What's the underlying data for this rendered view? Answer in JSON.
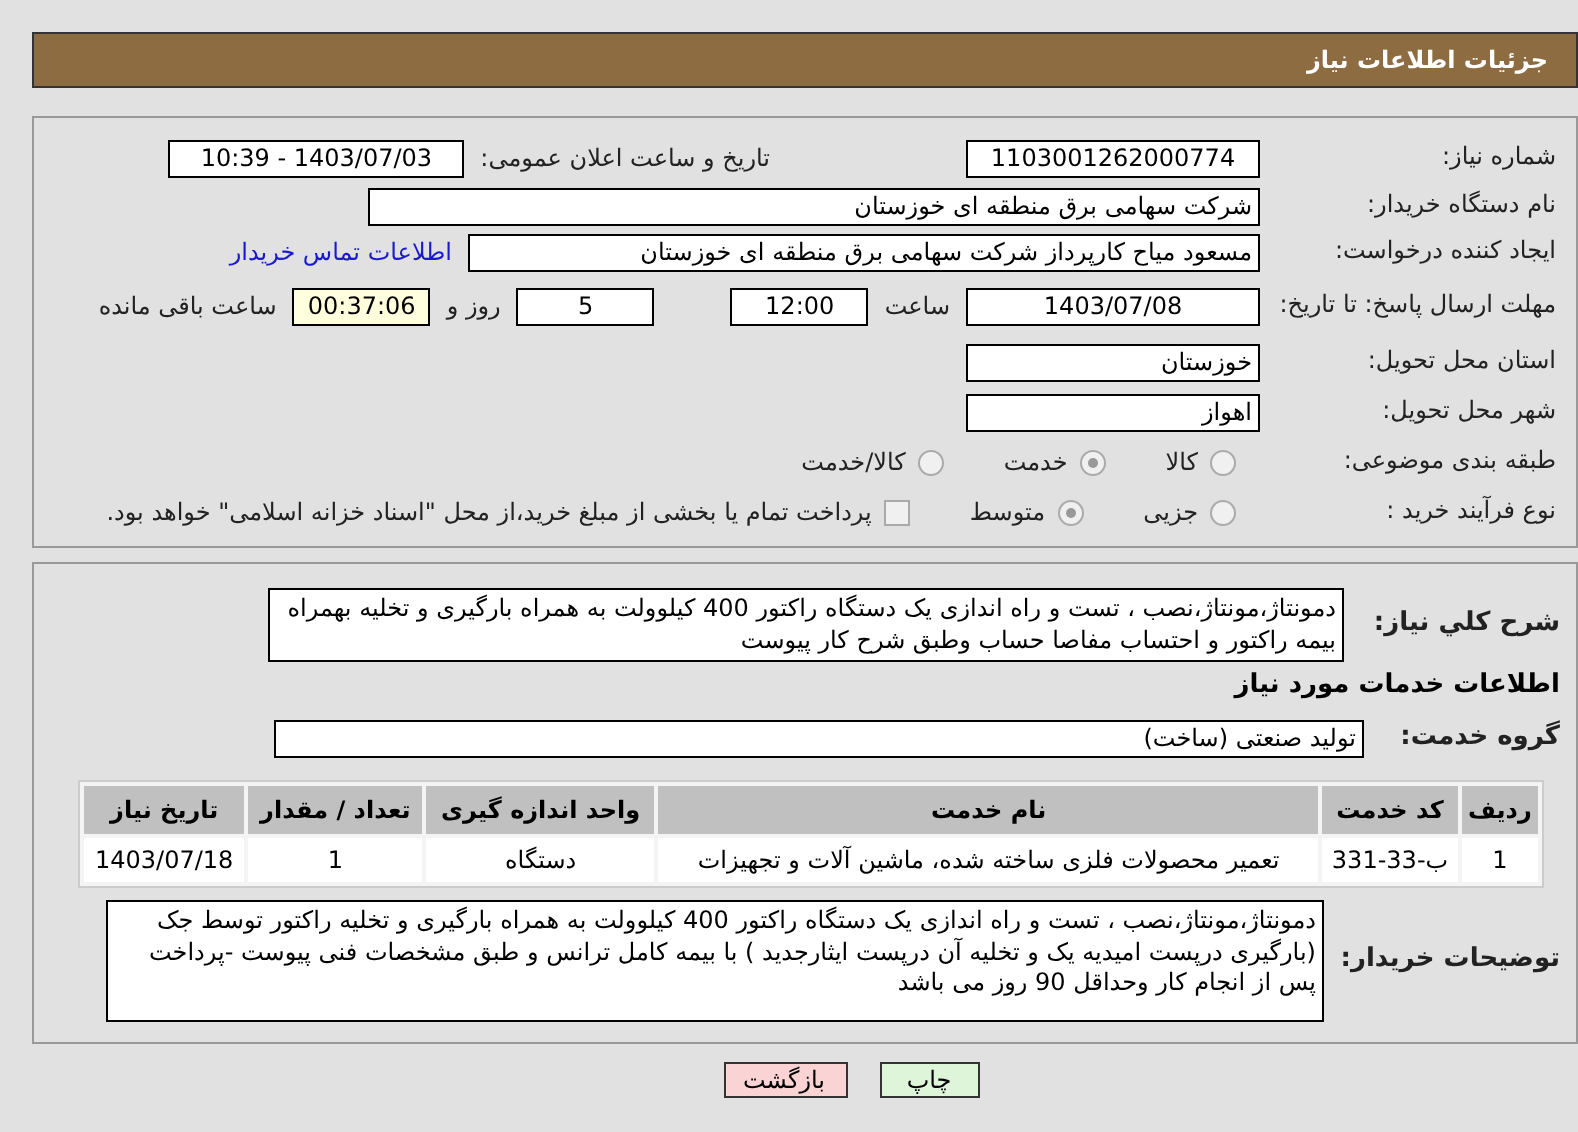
{
  "header": {
    "title": "جزئیات اطلاعات نیاز"
  },
  "details": {
    "need_number": {
      "label": "شماره نیاز:",
      "value": "1103001262000774"
    },
    "announce": {
      "label": "تاریخ و ساعت اعلان عمومی:",
      "value": "1403/07/03 - 10:39"
    },
    "buyer": {
      "label": "نام دستگاه خریدار:",
      "value": "شرکت سهامی برق منطقه ای خوزستان"
    },
    "creator": {
      "label": "ایجاد کننده درخواست:",
      "value": "مسعود میاح کارپرداز شرکت سهامی برق منطقه ای خوزستان",
      "link": "اطلاعات تماس خریدار"
    },
    "deadline": {
      "label": "مهلت ارسال پاسخ: تا تاریخ:",
      "date": "1403/07/08",
      "time_label": "ساعت",
      "time": "12:00",
      "days": "5",
      "days_label": "روز و",
      "remaining": "00:37:06",
      "remaining_label": "ساعت باقی مانده"
    },
    "province": {
      "label": "استان محل تحویل:",
      "value": "خوزستان"
    },
    "city": {
      "label": "شهر محل تحویل:",
      "value": "اهواز"
    },
    "classification": {
      "label": "طبقه بندی موضوعی:",
      "options": [
        {
          "label": "کالا",
          "selected": false
        },
        {
          "label": "خدمت",
          "selected": true
        },
        {
          "label": "کالا/خدمت",
          "selected": false
        }
      ]
    },
    "process": {
      "label": "نوع فرآیند خرید :",
      "options": [
        {
          "label": "جزیی",
          "selected": false
        },
        {
          "label": "متوسط",
          "selected": true
        }
      ],
      "payment": {
        "checked": false,
        "text": "پرداخت تمام یا بخشی از مبلغ خرید،از محل \"اسناد خزانه اسلامی\" خواهد بود."
      }
    }
  },
  "services": {
    "summary": {
      "label": "شرح کلي نياز:",
      "value": "دمونتاژ،مونتاژ،نصب ، تست و راه اندازی یک دستگاه راکتور 400 کیلوولت به همراه بارگیری و تخلیه بهمراه بیمه راکتور و احتساب مفاصا حساب وطبق شرح کار پیوست"
    },
    "section_title": "اطلاعات خدمات مورد نياز",
    "group": {
      "label": "گروه خدمت:",
      "value": "تولید صنعتی (ساخت)"
    },
    "table": {
      "columns": [
        "ردیف",
        "کد خدمت",
        "نام خدمت",
        "واحد اندازه گیری",
        "تعداد / مقدار",
        "تاریخ نیاز"
      ],
      "rows": [
        [
          "1",
          "ب-33-331",
          "تعمیر محصولات فلزی ساخته شده، ماشین آلات و تجهیزات",
          "دستگاه",
          "1",
          "1403/07/18"
        ]
      ]
    },
    "notes": {
      "label": "توضیحات خریدار:",
      "value": "دمونتاژ،مونتاژ،نصب ، تست و راه اندازی یک دستگاه راکتور 400 کیلوولت به همراه بارگیری و تخلیه راکتور توسط جک (بارگیری درپست امیدیه یک و تخلیه آن درپست ایثارجدید ) با بیمه کامل ترانس و طبق مشخصات فنی پیوست -پرداخت پس از انجام کار وحداقل 90 روز می باشد"
    }
  },
  "buttons": [
    {
      "kind": "print",
      "label": "چاپ"
    },
    {
      "kind": "back",
      "label": "بازگشت"
    }
  ]
}
